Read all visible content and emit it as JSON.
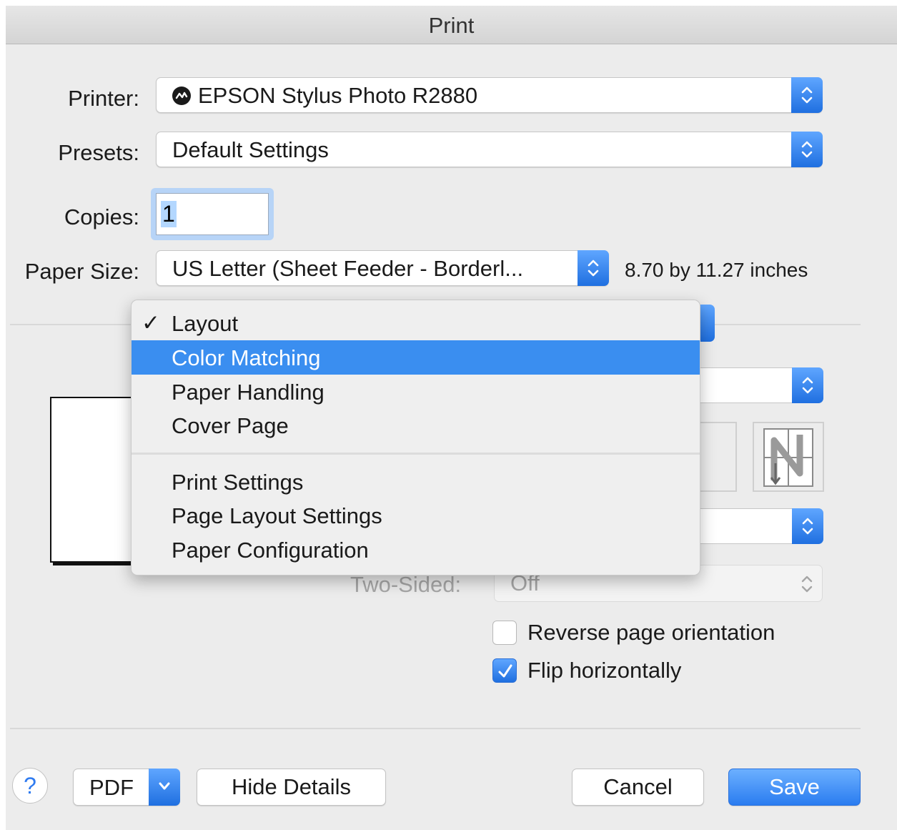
{
  "window": {
    "title": "Print"
  },
  "printer": {
    "label": "Printer:",
    "value": "EPSON Stylus Photo R2880",
    "icon": "printer-status-icon"
  },
  "presets": {
    "label": "Presets:",
    "value": "Default Settings"
  },
  "copies": {
    "label": "Copies:",
    "value": "1"
  },
  "paper_size": {
    "label": "Paper Size:",
    "value": "US Letter (Sheet Feeder - Borderl...",
    "dimensions": "8.70 by 11.27 inches"
  },
  "section_menu": {
    "selected": "Layout",
    "highlighted": "Color Matching",
    "group1": [
      "Layout",
      "Color Matching",
      "Paper Handling",
      "Cover Page"
    ],
    "group2": [
      "Print Settings",
      "Page Layout Settings",
      "Paper Configuration"
    ]
  },
  "two_sided": {
    "label": "Two-Sided:",
    "value": "Off"
  },
  "options": {
    "reverse_orientation": {
      "label": "Reverse page orientation",
      "checked": false
    },
    "flip_horizontally": {
      "label": "Flip horizontally",
      "checked": true
    }
  },
  "buttons": {
    "help": "?",
    "pdf": "PDF",
    "hide_details": "Hide Details",
    "cancel": "Cancel",
    "save": "Save"
  },
  "colors": {
    "accent": "#3a8ef0",
    "window_bg": "#ececec"
  }
}
